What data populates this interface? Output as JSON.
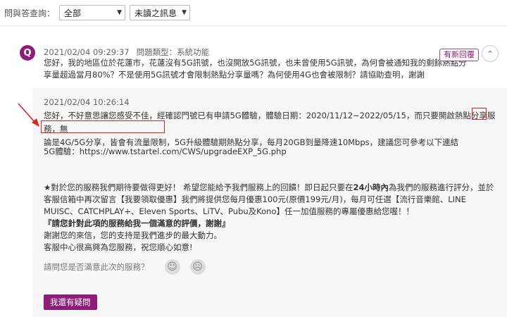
{
  "filter": {
    "label": "問與答查詢：",
    "select_type": "全部",
    "select_status": "未讀之訊息"
  },
  "question": {
    "avatar_letter": "Q",
    "timestamp": "2021/02/04 09:29:37",
    "type_label": "問題類型：系統功能",
    "text": "您好，我的地區位於花蓮市，花蓮沒有5G訊號，也沒開放5G訊號，也未曾使用5G訊號，為何會被通知我的剩餘熱點分享量超過當月80%？不是使用5G訊號才會限制熱點分享量嗎？為何使用4G也會被限制？請協助查明，謝謝",
    "new_reply_badge": "有新回覆"
  },
  "reply": {
    "timestamp": "2021/02/04 10:26:14",
    "p1_part1": "您好，不好意思讓您感受不佳，經確認門號已有申請5G體驗，體驗日期：2020/11/12~2022/05/15，而只要開啟熱點分享服務，",
    "p1_hl_a": "無",
    "p1_hl_b": "論是4G/5G分享，皆會有流量限制",
    "p1_part2": "，5G升級體驗期熱點分享，每月20GB到量降速10Mbps，建議您可參考以下連結",
    "url_line": "5G體驗：https://www.tstartel.com/CWS/upgradeEXP_5G.php",
    "p2_line1_a": "★對於您的服務我們期待要做得更好！ 希望您能給予我們服務上的回饋！即日起只要在",
    "p2_line1_b": "24小時內",
    "p2_line1_c": "為我們的服務進行評分，並於客服信箱中再次留言【我要領取優惠】我們將提供您每月優惠100元(原價199元/月)，每月可任選【流行音樂館、LINE MUISC、CATCHPLAY+、Eleven Sports、LiTV、Pubu及Kono】任一加值服務的專屬優惠給您喔！！",
    "p2_line2": "『請您針對此項的服務給我一個滿意的評價，謝謝』",
    "p2_line3": "謝謝您的來信，您的支持是我們進步的最大動力。",
    "p2_line4": "客服中心很高興為您服務，祝您順心如意!",
    "satisfaction_question": "請問您是否滿意此次的服務？",
    "more_question_button": "我還有疑問"
  },
  "colors": {
    "brand": "#8c1e79",
    "annotation": "#e0211f"
  }
}
